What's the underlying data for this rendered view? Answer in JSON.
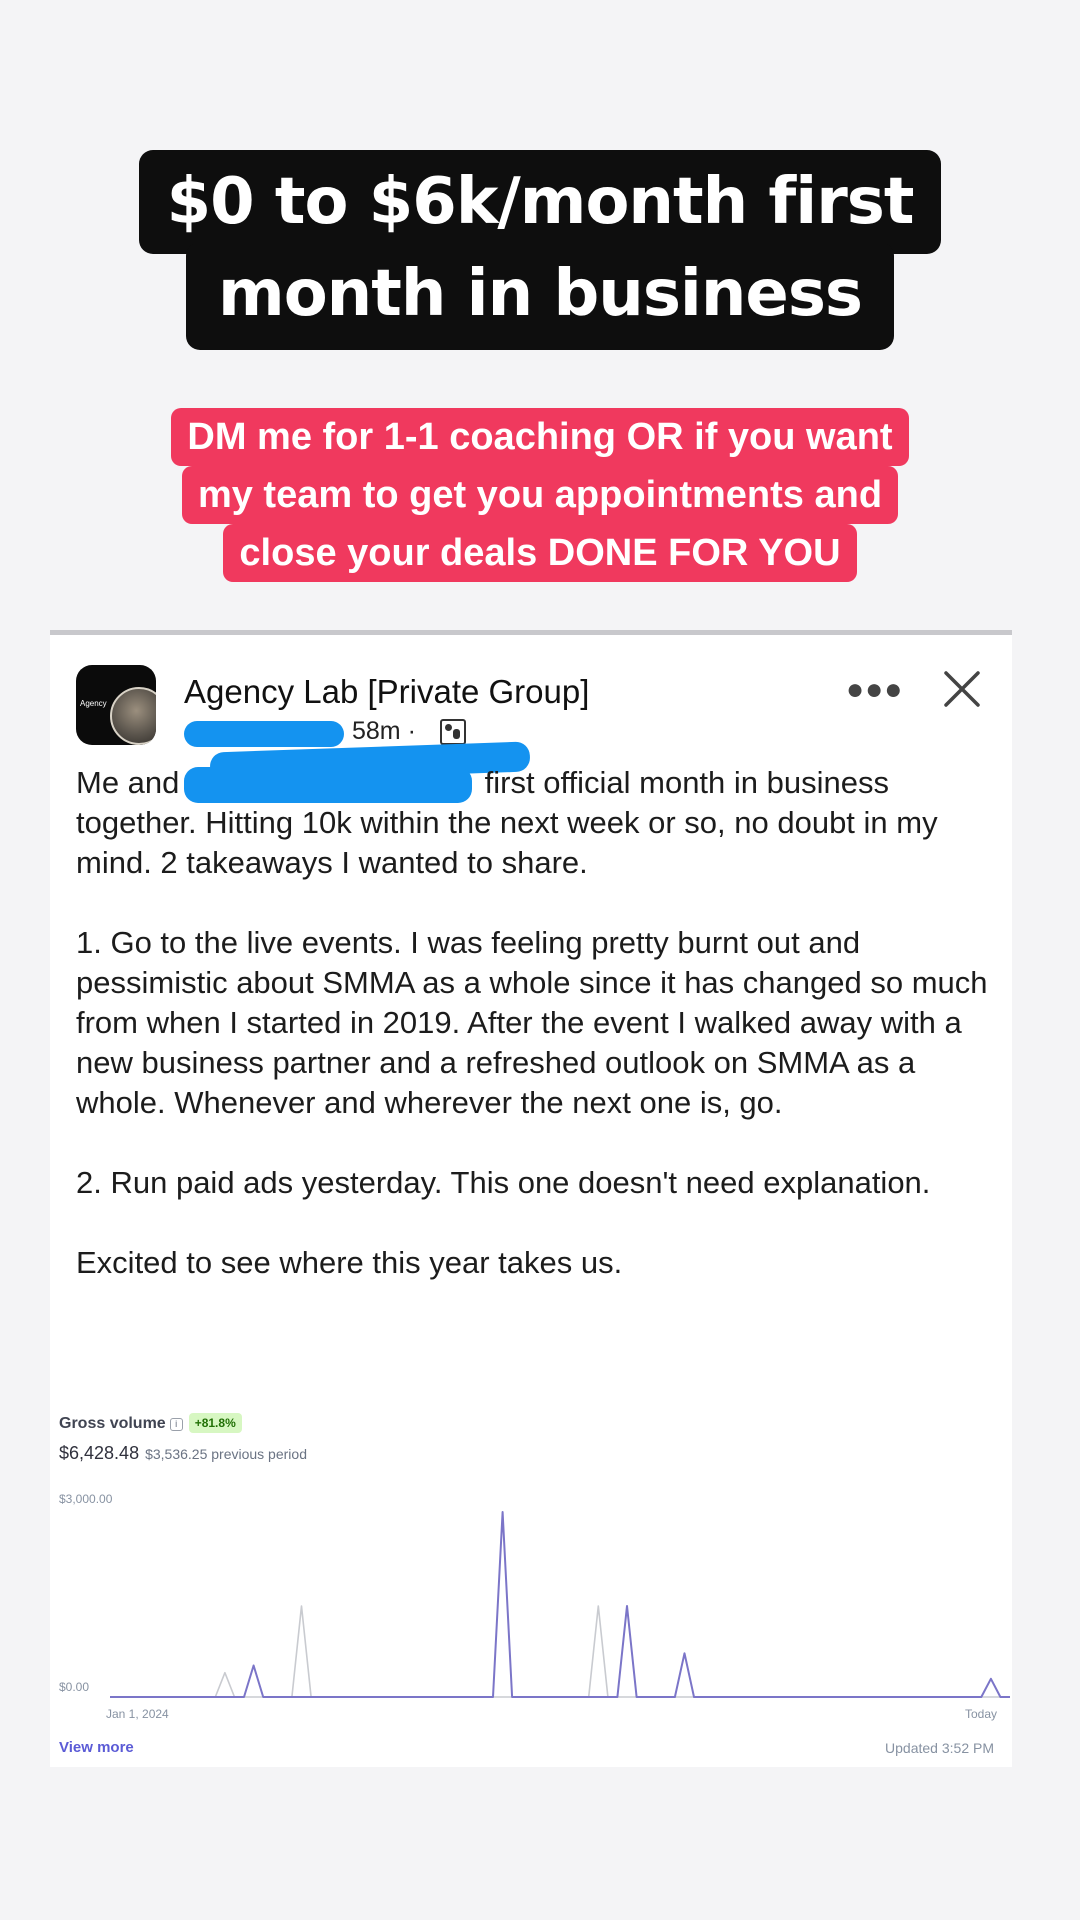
{
  "headline": {
    "line1": "$0 to $6k/month first",
    "line2": "month in business"
  },
  "cta": {
    "line1": "DM me for 1-1 coaching OR if you want",
    "line2": "my team to get you appointments and",
    "line3": "close your deals DONE FOR YOU"
  },
  "post": {
    "group_name": "Agency Lab [Private Group]",
    "avatar_text": "Agency",
    "time": "58m ·",
    "more_icon": "more-dots-icon",
    "close_icon": "close-icon",
    "paragraph1_start": "Me and",
    "paragraph1_rest": "first official month in business together. Hitting 10k within the next week or so, no doubt in my mind. 2 takeaways I wanted to share.",
    "paragraph2": "1. Go to the live events. I was feeling pretty burnt out and pessimistic about SMMA as a whole since it has changed so much from when I started in 2019. After the event I walked away with a new business partner and a refreshed outlook on SMMA as a whole. Whenever and wherever the next one is, go.",
    "paragraph3": "2. Run paid ads yesterday. This one doesn't need explanation.",
    "paragraph4": "Excited to see where this year takes us."
  },
  "dashboard": {
    "title": "Gross volume",
    "badge": "+81.8%",
    "amount": "$6,428.48",
    "previous": "$3,536.25 previous period",
    "view_more": "View more",
    "updated": "Updated 3:52 PM",
    "accent_color": "#7b75c8",
    "previous_color": "#c9cbd0"
  },
  "chart_data": {
    "type": "line",
    "y_tick_labels": [
      "$3,000.00",
      "$0.00"
    ],
    "x_tick_labels": [
      "Jan 1, 2024",
      "Today"
    ],
    "ylim": [
      0,
      3000
    ],
    "grid": false,
    "series": [
      {
        "values": [
          0,
          0,
          0,
          0,
          0,
          0,
          0,
          0,
          0,
          0,
          0,
          0,
          0,
          0,
          0,
          520,
          0,
          0,
          0,
          0,
          0,
          0,
          0,
          0,
          0,
          0,
          0,
          0,
          0,
          0,
          0,
          0,
          0,
          0,
          0,
          0,
          0,
          0,
          0,
          0,
          0,
          3050,
          0,
          0,
          0,
          0,
          0,
          0,
          0,
          0,
          0,
          0,
          0,
          0,
          1500,
          0,
          0,
          0,
          0,
          0,
          720,
          0,
          0,
          0,
          0,
          0,
          0,
          0,
          0,
          0,
          0,
          0,
          0,
          0,
          0,
          0,
          0,
          0,
          0,
          0,
          0,
          0,
          0,
          0,
          0,
          0,
          0,
          0,
          0,
          0,
          0,
          0,
          300,
          0,
          0
        ]
      },
      {
        "values": [
          0,
          0,
          0,
          0,
          0,
          0,
          0,
          0,
          0,
          0,
          0,
          0,
          400,
          0,
          0,
          0,
          0,
          0,
          0,
          0,
          1500,
          0,
          0,
          0,
          0,
          0,
          0,
          0,
          0,
          0,
          0,
          0,
          0,
          0,
          0,
          0,
          0,
          0,
          0,
          0,
          0,
          0,
          0,
          0,
          0,
          0,
          0,
          0,
          0,
          0,
          0,
          1500,
          0,
          0,
          0,
          0,
          0,
          0,
          0,
          0,
          0,
          0,
          0,
          0,
          0,
          0,
          0,
          0,
          0,
          0,
          0,
          0,
          0,
          0,
          0,
          0,
          0,
          0,
          0,
          0,
          0,
          0,
          0,
          0,
          0,
          0,
          0,
          0,
          0,
          0,
          0,
          0,
          0,
          0,
          0
        ]
      }
    ]
  }
}
